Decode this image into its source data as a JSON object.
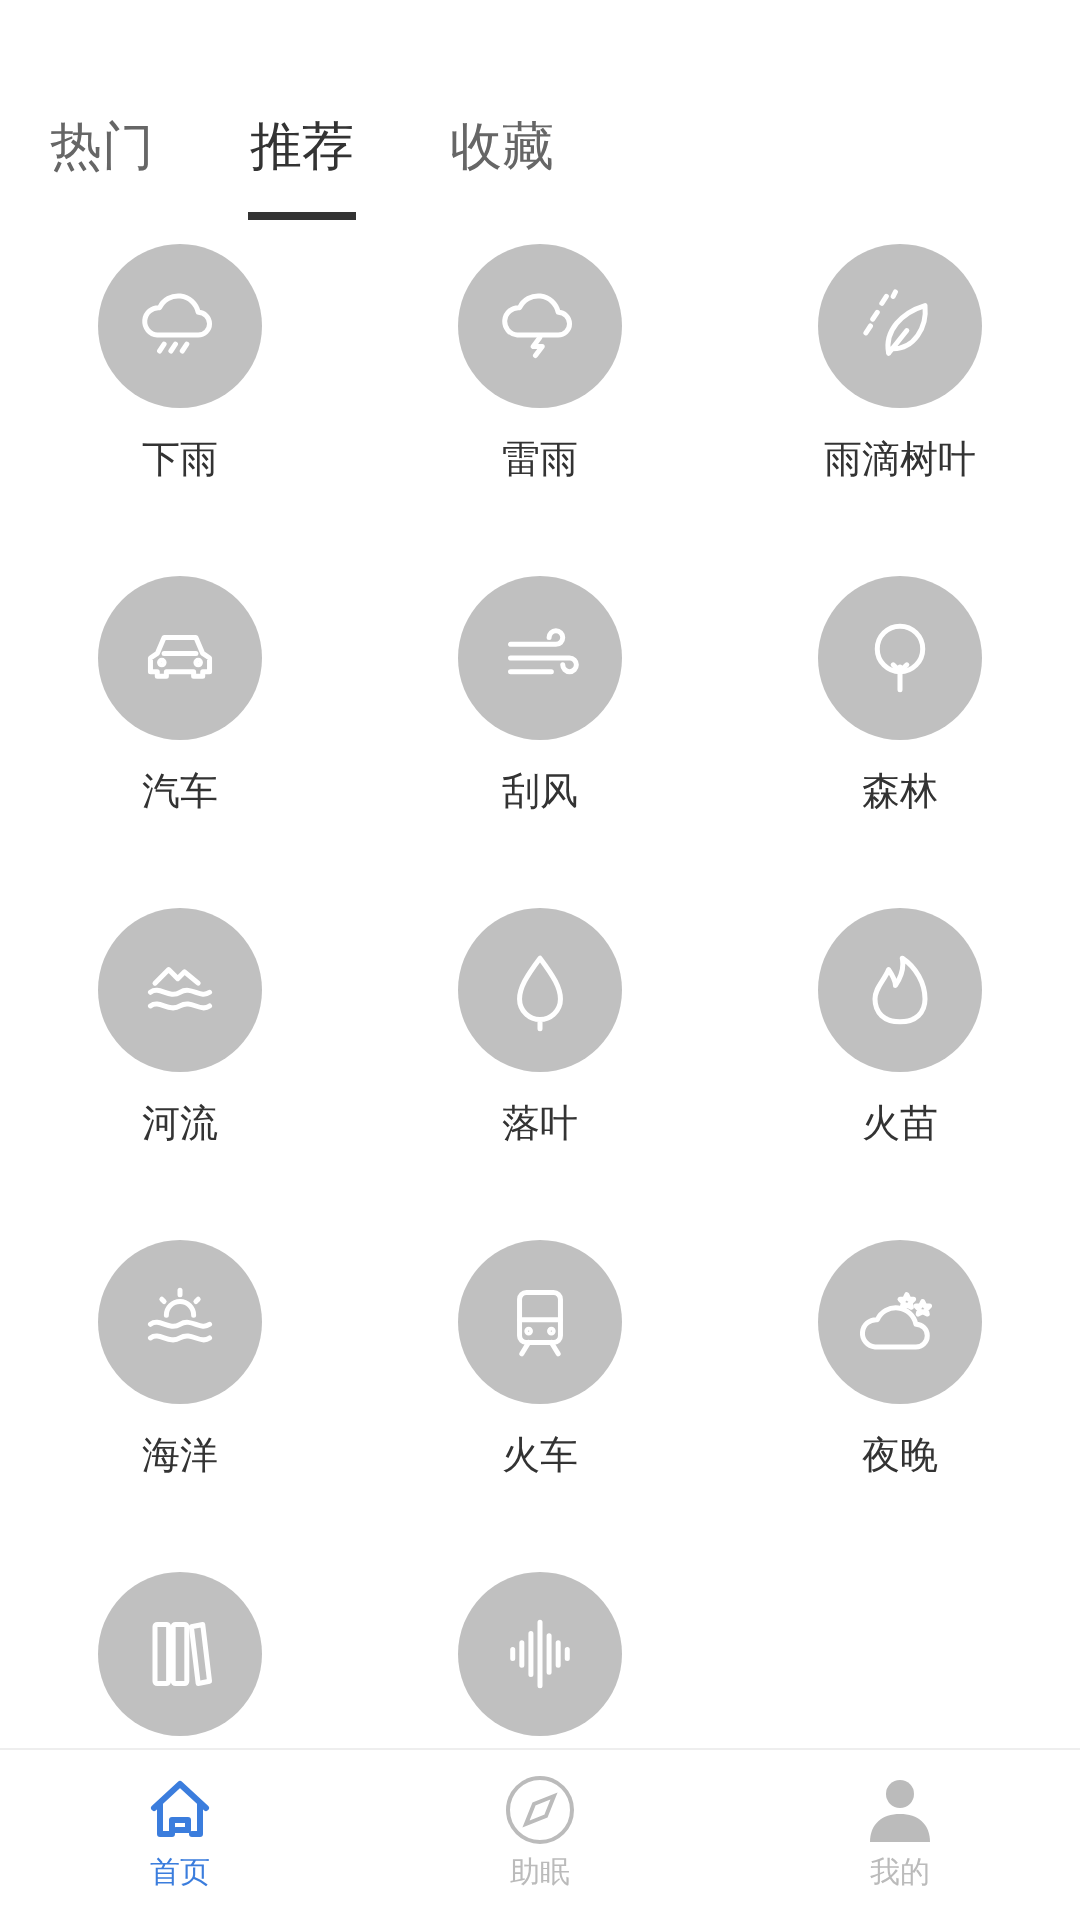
{
  "tabs": [
    {
      "label": "热门",
      "selected": false
    },
    {
      "label": "推荐",
      "selected": true
    },
    {
      "label": "收藏",
      "selected": false
    }
  ],
  "sounds": [
    {
      "kind": "labeled",
      "label": "下雨"
    },
    {
      "kind": "labeled",
      "label": "雷雨"
    },
    {
      "kind": "labeled",
      "label": "雨滴树叶"
    },
    {
      "kind": "labeled",
      "label": "汽车"
    },
    {
      "kind": "labeled",
      "label": "刮风"
    },
    {
      "kind": "labeled",
      "label": "森林"
    },
    {
      "kind": "labeled",
      "label": "河流"
    },
    {
      "kind": "labeled",
      "label": "落叶"
    },
    {
      "kind": "labeled",
      "label": "火苗"
    },
    {
      "kind": "labeled",
      "label": "海洋"
    },
    {
      "kind": "labeled",
      "label": "火车"
    },
    {
      "kind": "labeled",
      "label": "夜晚"
    },
    {
      "kind": "icon_only"
    },
    {
      "kind": "icon_only"
    }
  ],
  "bottom_nav": [
    {
      "label": "首页",
      "selected": true
    },
    {
      "label": "助眠",
      "selected": false
    },
    {
      "label": "我的",
      "selected": false
    }
  ]
}
